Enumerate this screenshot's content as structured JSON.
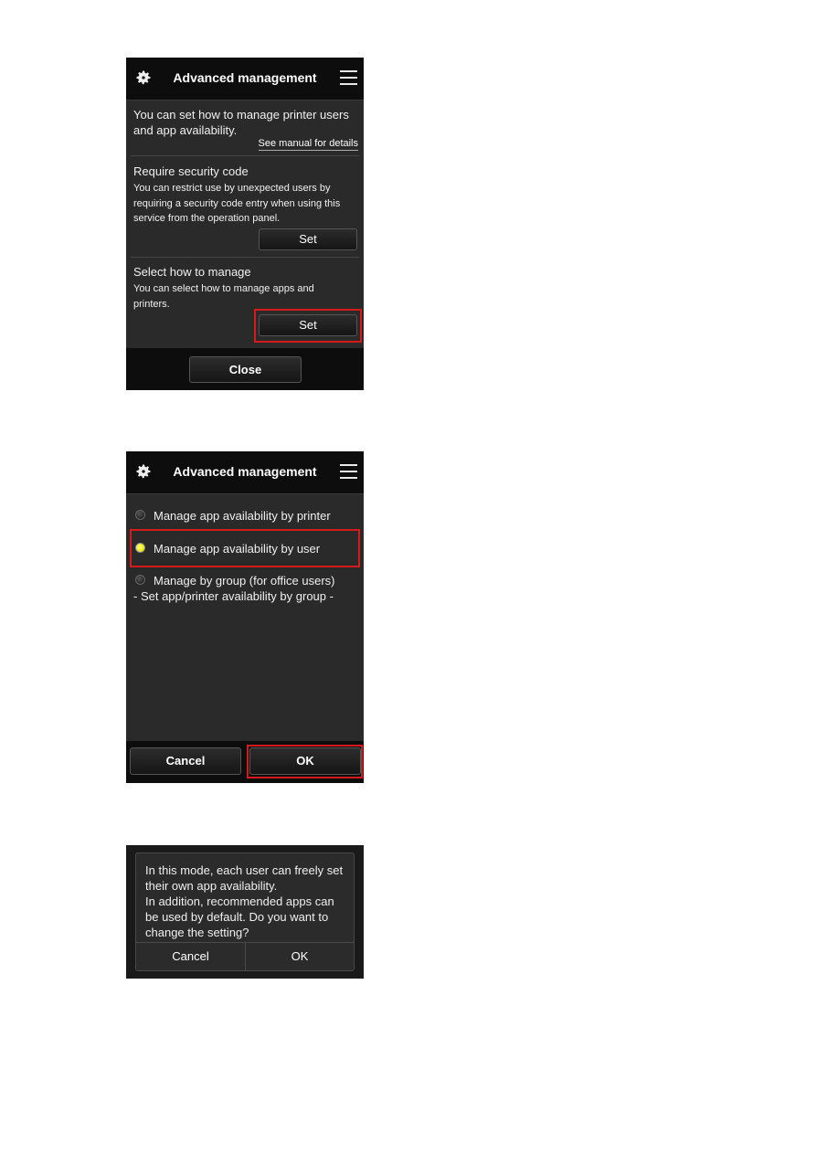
{
  "screen1": {
    "title": "Advanced management",
    "intro": "You can set how to manage printer users and app availability.",
    "manual_link": "See manual for details",
    "sections": [
      {
        "heading": "Require security code",
        "description": "You can restrict use by unexpected users by requiring a security code entry when using this service from the operation panel.",
        "button": "Set"
      },
      {
        "heading": "Select how to manage",
        "description": "You can select how to manage apps and printers.",
        "button": "Set",
        "highlighted": true
      }
    ],
    "close_button": "Close"
  },
  "screen2": {
    "title": "Advanced management",
    "options": [
      {
        "label": "Manage app availability by printer",
        "selected": false
      },
      {
        "label": "Manage app availability by user",
        "selected": true
      },
      {
        "label": "Manage by group (for office users)",
        "selected": false,
        "sublabel": "- Set app/printer availability by group -"
      }
    ],
    "cancel_button": "Cancel",
    "ok_button": "OK"
  },
  "screen3": {
    "message_lines": [
      "In this mode, each user can freely set",
      "their own app availability.",
      "In addition, recommended apps can",
      "be used by default. Do you want to",
      "change the setting?"
    ],
    "cancel_button": "Cancel",
    "ok_button": "OK"
  },
  "icons": {
    "settings": "gear-icon",
    "menu": "hamburger-menu-icon"
  },
  "colors": {
    "highlight": "#d41a1a",
    "radio_selected": "#f0f000",
    "header_bg": "#0d0d0d",
    "panel_bg": "#2a2a2a"
  }
}
